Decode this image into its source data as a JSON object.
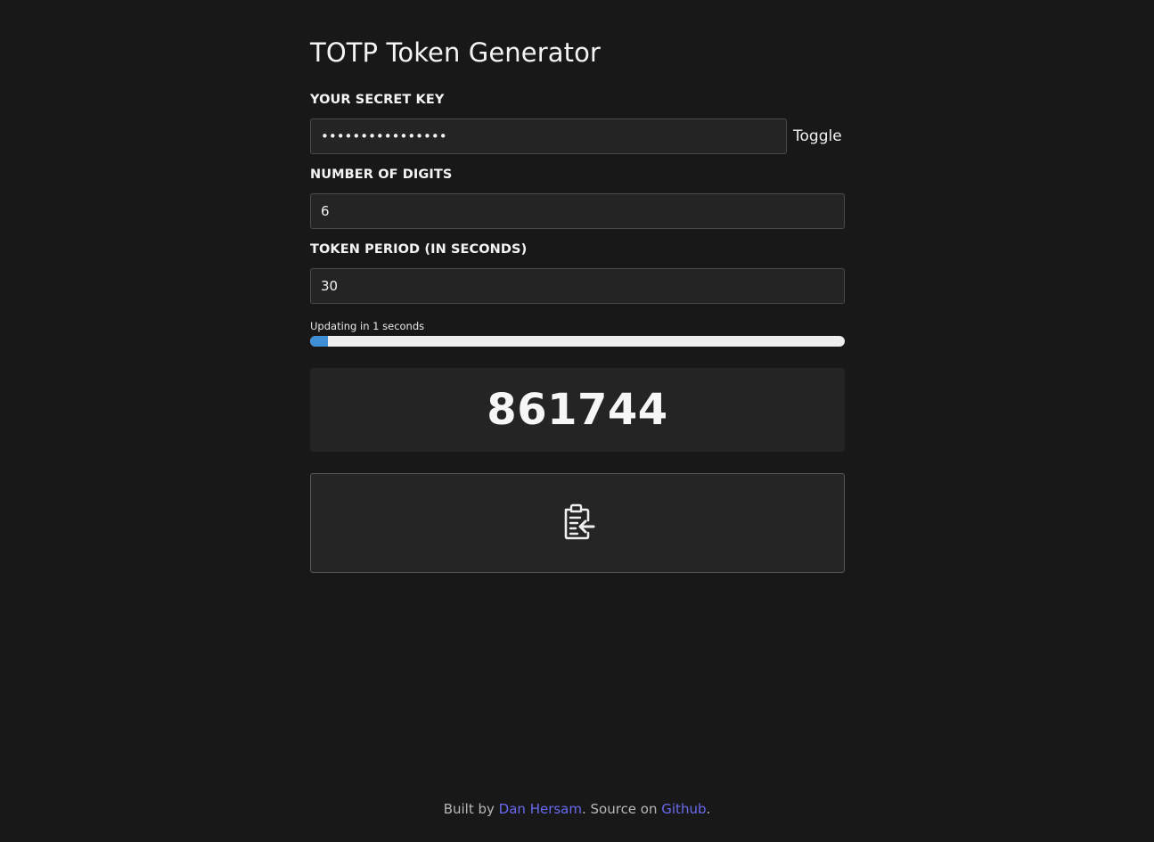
{
  "page": {
    "title": "TOTP Token Generator"
  },
  "secret": {
    "label": "YOUR SECRET KEY",
    "value": "••••••••••••••••",
    "toggle_label": "Toggle"
  },
  "digits": {
    "label": "NUMBER OF DIGITS",
    "value": "6"
  },
  "period": {
    "label": "TOKEN PERIOD (IN SECONDS)",
    "value": "30"
  },
  "countdown": {
    "text": "Updating in 1 seconds",
    "progress_fraction": 0.033,
    "fill_color": "#3f8fd6"
  },
  "token": {
    "value": "861744"
  },
  "copy": {
    "icon": "clipboard-paste-icon"
  },
  "footer": {
    "prefix": "Built by ",
    "author_link": "Dan Hersam",
    "middle": ". Source on ",
    "source_link": "Github",
    "suffix": "."
  },
  "colors": {
    "background": "#181818",
    "field_background": "#242424",
    "link": "#6a6af0"
  }
}
